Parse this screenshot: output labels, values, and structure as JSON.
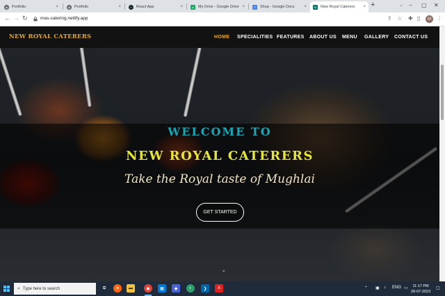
{
  "browser": {
    "tabs": [
      {
        "label": "Portfolio",
        "color": "#5f6368"
      },
      {
        "label": "Portfolio",
        "color": "#5f6368"
      },
      {
        "label": "React App",
        "color": "#20232a"
      },
      {
        "label": "My Drive - Google Drive",
        "color": "#1fa463"
      },
      {
        "label": "Shop - Google Docs",
        "color": "#4285f4"
      },
      {
        "label": "New Royal Caterers",
        "color": "#0f766e",
        "active": true
      }
    ],
    "url": "mas-catering.netlify.app",
    "profile_initial": "M"
  },
  "site": {
    "brand": "NEW ROYAL CATERERS",
    "nav": [
      "HOME",
      "SPECIALITIES",
      "FEATURES",
      "ABOUT US",
      "MENU",
      "GALLERY",
      "CONTACT US"
    ],
    "hero": {
      "welcome": "WELCOME TO",
      "title": "NEW ROYAL CATERERS",
      "tagline": "Take the Royal taste of Mughlai",
      "cta": "GET STARTED"
    },
    "colors": {
      "brand": "#e0a832",
      "welcome": "#1aa6b5",
      "title": "#e6e63a",
      "nav_active": "#e8a82e"
    }
  },
  "taskbar": {
    "search_placeholder": "Type here to search",
    "language": "ENG",
    "time": "11:17 PM",
    "date": "28-07-2023"
  }
}
